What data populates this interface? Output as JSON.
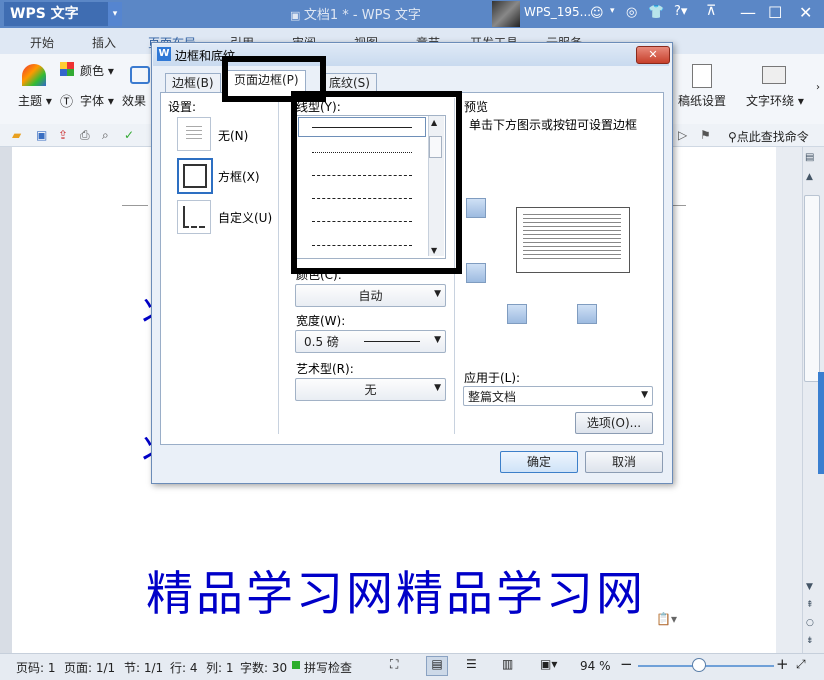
{
  "app": {
    "brand": "WPS 文字",
    "doc_title": "文档1 * - WPS 文字",
    "user_name": "WPS_195..."
  },
  "ribbon_tabs": [
    "开始",
    "插入",
    "页面布局",
    "引用",
    "审阅",
    "视图",
    "章节",
    "开发工具",
    "云服务"
  ],
  "ribbon": {
    "theme_label": "主题",
    "color_label": "颜色",
    "font_label": "字体",
    "effect_label": "效果",
    "paper_setting_label": "稿纸设置",
    "text_wrap_label": "文字环绕",
    "search_label": "点此查找命令"
  },
  "document": {
    "big_text": "精品学习网精品学习网",
    "partial_glyph": "丬"
  },
  "dialog": {
    "title": "边框和底纹",
    "tabs": [
      "边框(B)",
      "页面边框(P)",
      "底纹(S)"
    ],
    "settings_label": "设置:",
    "settings": [
      "无(N)",
      "方框(X)",
      "自定义(U)"
    ],
    "line_style_label": "线型(Y):",
    "color_label": "颜色(C):",
    "color_value": "自动",
    "width_label": "宽度(W):",
    "width_value": "0.5  磅",
    "art_label": "艺术型(R):",
    "art_value": "无",
    "preview_label": "预览",
    "preview_hint": "单击下方图示或按钮可设置边框",
    "apply_to_label": "应用于(L):",
    "apply_to_value": "整篇文档",
    "options_button": "选项(O)...",
    "ok_button": "确定",
    "cancel_button": "取消"
  },
  "status": {
    "page_num": "页码: 1",
    "pages": "页面: 1/1",
    "section": "节: 1/1",
    "row": "行: 4",
    "col": "列: 1",
    "word_count": "字数: 30",
    "spell_check": "拼写检查",
    "zoom": "94 %",
    "zoom_fraction": 0.45
  }
}
